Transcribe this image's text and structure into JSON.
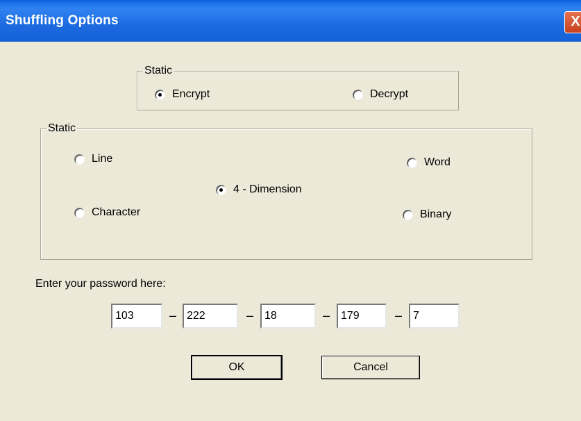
{
  "window": {
    "title": "Shuffling Options",
    "close_glyph": "X"
  },
  "mode_group": {
    "legend": "Static",
    "options": [
      {
        "label": "Encrypt",
        "checked": true
      },
      {
        "label": "Decrypt",
        "checked": false
      }
    ]
  },
  "method_group": {
    "legend": "Static",
    "options": [
      {
        "label": "Line",
        "checked": false
      },
      {
        "label": "Word",
        "checked": false
      },
      {
        "label": "4 - Dimension",
        "checked": true
      },
      {
        "label": "Character",
        "checked": false
      },
      {
        "label": "Binary",
        "checked": false
      }
    ]
  },
  "password": {
    "label": "Enter your password here:",
    "separator": "–",
    "fields": [
      "103",
      "222",
      "18",
      "179",
      "7"
    ]
  },
  "buttons": {
    "ok": "OK",
    "cancel": "Cancel"
  }
}
